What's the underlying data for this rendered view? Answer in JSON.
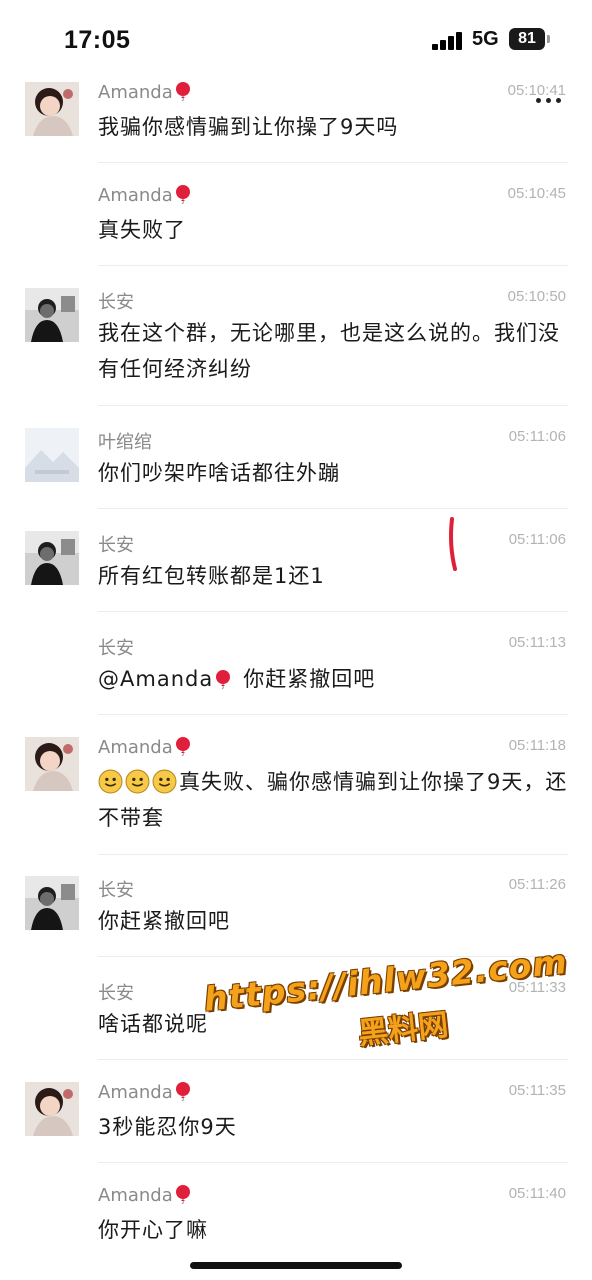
{
  "status_bar": {
    "time": "17:05",
    "network": "5G",
    "battery": "81"
  },
  "header": {
    "more_icon": "more-dots-icon"
  },
  "messages": [
    {
      "sender": "Amanda",
      "balloon": true,
      "timestamp": "05:10:41",
      "text": "我骗你感情骗到让你操了9天吗",
      "avatar": "amanda"
    },
    {
      "sender": "Amanda",
      "balloon": true,
      "timestamp": "05:10:45",
      "text": "真失败了",
      "avatar": "none"
    },
    {
      "sender": "长安",
      "balloon": false,
      "timestamp": "05:10:50",
      "text": "我在这个群，无论哪里，也是这么说的。我们没有任何经济纠纷",
      "avatar": "changan"
    },
    {
      "sender": "叶绾绾",
      "balloon": false,
      "timestamp": "05:11:06",
      "text": "你们吵架咋啥话都往外蹦",
      "avatar": "yewanwan"
    },
    {
      "sender": "长安",
      "balloon": false,
      "timestamp": "05:11:06",
      "text": "所有红包转账都是1还1",
      "avatar": "changan"
    },
    {
      "sender": "长安",
      "balloon": false,
      "timestamp": "05:11:13",
      "text_prefix": "@Amanda",
      "text": "你赶紧撤回吧",
      "avatar": "none"
    },
    {
      "sender": "Amanda",
      "balloon": true,
      "timestamp": "05:11:18",
      "text": "真失败、骗你感情骗到让你操了9天，还不带套",
      "avatar": "amanda",
      "emoji_count": 3
    },
    {
      "sender": "长安",
      "balloon": false,
      "timestamp": "05:11:26",
      "text": "你赶紧撤回吧",
      "avatar": "changan"
    },
    {
      "sender": "长安",
      "balloon": false,
      "timestamp": "05:11:33",
      "text": "啥话都说呢",
      "avatar": "none"
    },
    {
      "sender": "Amanda",
      "balloon": true,
      "timestamp": "05:11:35",
      "text": "3秒能忍你9天",
      "avatar": "amanda"
    },
    {
      "sender": "Amanda",
      "balloon": true,
      "timestamp": "05:11:40",
      "text": "你开心了嘛",
      "avatar": "none"
    }
  ],
  "watermark": {
    "url": "https://ihlw32.com",
    "name": "黑料网"
  },
  "colors": {
    "accent_red": "#e0203a",
    "watermark_orange": "#f5a21b"
  }
}
